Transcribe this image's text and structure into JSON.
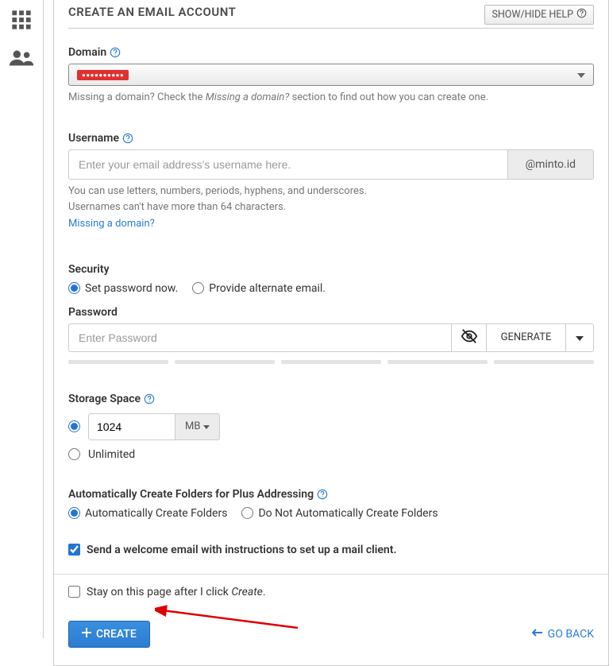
{
  "header": {
    "title": "CREATE AN EMAIL ACCOUNT",
    "help_button": "SHOW/HIDE HELP"
  },
  "domain": {
    "label": "Domain",
    "selected": "●●●●●●●●●●",
    "hint_pre": "Missing a domain? Check the ",
    "hint_em": "Missing a domain?",
    "hint_post": " section to find out how you can create one."
  },
  "username": {
    "label": "Username",
    "placeholder": "Enter your email address's username here.",
    "suffix": "@minto.id",
    "hint1": "You can use letters, numbers, periods, hyphens, and underscores.",
    "hint2": "Usernames can't have more than 64 characters.",
    "link": "Missing a domain?"
  },
  "security": {
    "label": "Security",
    "opt_setnow": "Set password now.",
    "opt_altemail": "Provide alternate email."
  },
  "password": {
    "label": "Password",
    "placeholder": "Enter Password",
    "generate": "GENERATE"
  },
  "storage": {
    "label": "Storage Space",
    "value": "1024",
    "unit": "MB",
    "unlimited": "Unlimited"
  },
  "plus": {
    "label": "Automatically Create Folders for Plus Addressing",
    "opt_auto": "Automatically Create Folders",
    "opt_noauto": "Do Not Automatically Create Folders"
  },
  "welcome": {
    "label": "Send a welcome email with instructions to set up a mail client."
  },
  "footer": {
    "stay_pre": "Stay on this page after I click ",
    "stay_em": "Create",
    "stay_post": ".",
    "create": "CREATE",
    "goback": "GO BACK"
  }
}
